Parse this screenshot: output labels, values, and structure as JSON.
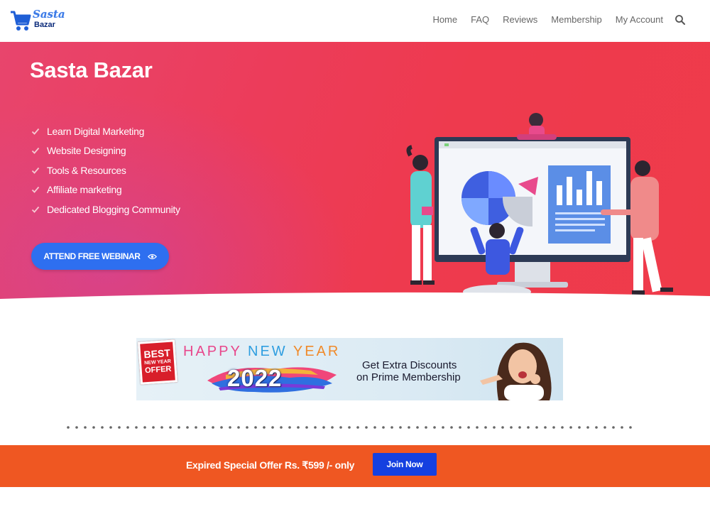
{
  "brand": {
    "name_line1": "Sasta",
    "name_line2": "Bazar"
  },
  "nav": {
    "items": [
      "Home",
      "FAQ",
      "Reviews",
      "Membership",
      "My Account"
    ]
  },
  "hero": {
    "title": "Sasta Bazar",
    "features": [
      "Learn Digital Marketing",
      "Website Designing",
      "Tools & Resources",
      "Affiliate marketing",
      "Dedicated Blogging Community"
    ],
    "cta_label": "ATTEND FREE WEBINAR"
  },
  "banner": {
    "badge_line1": "BEST",
    "badge_line2": "NEW YEAR",
    "badge_line3": "OFFER",
    "greeting_word1": "HAPPY",
    "greeting_word2": "NEW",
    "greeting_word3": "YEAR",
    "year": "2022",
    "promo_line1": "Get Extra Discounts",
    "promo_line2": "on Prime Membership"
  },
  "offer_bar": {
    "text": "Expired Special Offer Rs. ₹599 /- only",
    "button_label": "Join Now"
  },
  "colors": {
    "hero_gradient_start": "#e8456d",
    "hero_gradient_end": "#ef3b4a",
    "cta_blue": "#2e6ff0",
    "offer_orange": "#ef5722",
    "join_blue": "#1440e0"
  },
  "icons": [
    "cart-icon",
    "search-icon",
    "check-icon",
    "eye-icon"
  ]
}
